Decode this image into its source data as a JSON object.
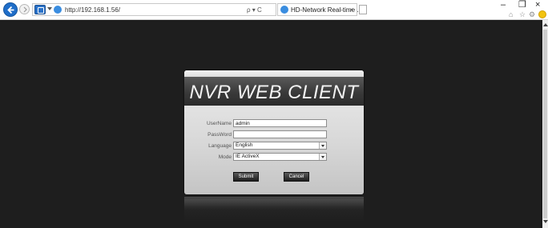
{
  "browser": {
    "url": "http://192.168.1.56/",
    "addr_tools": "ρ ▾ C",
    "tab_title": "HD-Network Real-time ...",
    "tab_close": "×",
    "window_controls": {
      "minimize": "–",
      "maximize": "❐",
      "close": "×"
    },
    "toolbar_icons": {
      "home": "⌂",
      "favorites": "☆",
      "settings": "⚙"
    }
  },
  "login": {
    "title": "NVR WEB CLIENT",
    "fields": {
      "username_label": "UserName",
      "username_value": "admin",
      "password_label": "PassWord",
      "password_value": "",
      "language_label": "Language",
      "language_value": "English",
      "mode_label": "Mode",
      "mode_value": "IE ActiveX"
    },
    "submit_label": "Submit",
    "cancel_label": "Cancel"
  },
  "colors": {
    "page_bg": "#1e1e1e",
    "title_band": "#3a3a3a",
    "panel_light": "#ededed",
    "accent_blue": "#1f6ec9"
  }
}
